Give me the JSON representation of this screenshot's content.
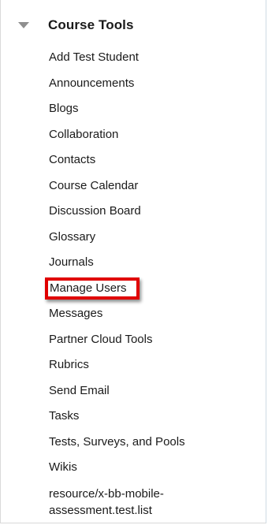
{
  "menu": {
    "title": "Course Tools",
    "items": [
      {
        "label": "Add Test Student"
      },
      {
        "label": "Announcements"
      },
      {
        "label": "Blogs"
      },
      {
        "label": "Collaboration"
      },
      {
        "label": "Contacts"
      },
      {
        "label": "Course Calendar"
      },
      {
        "label": "Discussion Board"
      },
      {
        "label": "Glossary"
      },
      {
        "label": "Journals"
      },
      {
        "label": "Manage Users"
      },
      {
        "label": "Messages"
      },
      {
        "label": "Partner Cloud Tools"
      },
      {
        "label": "Rubrics"
      },
      {
        "label": "Send Email"
      },
      {
        "label": "Tasks"
      },
      {
        "label": "Tests, Surveys, and Pools"
      },
      {
        "label": "Wikis"
      },
      {
        "label": "resource/x-bb-mobile-assessment.test.list"
      }
    ]
  },
  "colors": {
    "highlight_border": "#e00000",
    "toggle_arrow": "#8f8f8f",
    "text": "#1a1a1a"
  }
}
